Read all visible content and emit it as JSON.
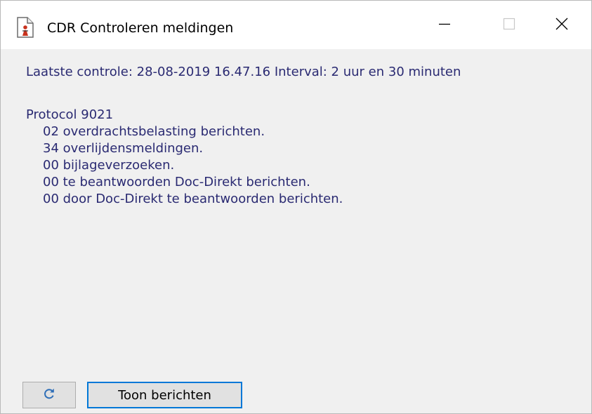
{
  "window": {
    "title": "CDR Controleren meldingen",
    "icon": "document-person-icon",
    "controls": [
      "minimize-icon",
      "maximize-icon",
      "close-icon"
    ]
  },
  "status": {
    "last_check_line": "Laatste controle: 28-08-2019 16.47.16 Interval: 2 uur en 30 minuten"
  },
  "protocol": {
    "heading": "Protocol 9021",
    "lines": [
      "02 overdrachtsbelasting berichten.",
      "34 overlijdensmeldingen.",
      "00 bijlageverzoeken.",
      "00 te beantwoorden Doc-Direkt berichten.",
      "00 door Doc-Direkt te beantwoorden berichten."
    ]
  },
  "buttons": {
    "refresh_icon": "refresh-icon",
    "show_messages": "Toon berichten"
  },
  "colors": {
    "text": "#2a2a72",
    "focus_border": "#0078d7",
    "refresh_icon": "#2f6fb8",
    "background": "#f0f0f0"
  }
}
